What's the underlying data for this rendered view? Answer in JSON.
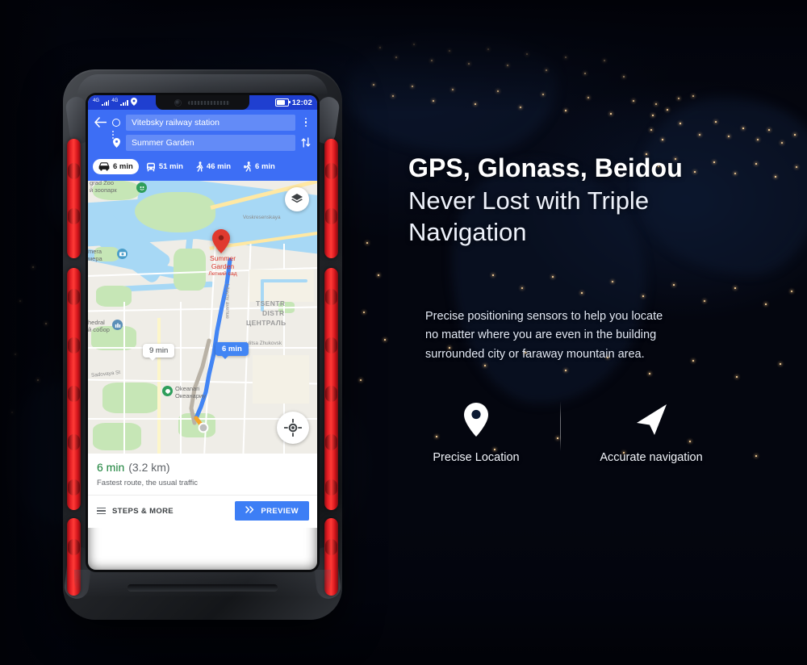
{
  "background": {
    "scene": "night-earth-satellite",
    "base_color": "#04060f",
    "city_light_color": "#ffd9a0"
  },
  "panel": {
    "headline_bold": "GPS, Glonass, Beidou",
    "headline_light_line1": "Never Lost with Triple",
    "headline_light_line2": "Navigation",
    "description_line1": "Precise positioning sensors to help you locate",
    "description_line2": "no matter where you are even in the building",
    "description_line3": "surrounded city or faraway mountain area."
  },
  "features": [
    {
      "icon": "map-pin-icon",
      "label": "Precise Location"
    },
    {
      "icon": "navigation-arrow-icon",
      "label": "Accurate navigation"
    }
  ],
  "phone": {
    "accent_color": "#e01b22",
    "body_color": "#26282d",
    "statusbar": {
      "network_1": "4G",
      "network_2": "4G",
      "location_icon": "location-icon",
      "battery_icon": "battery-icon",
      "clock": "12:02"
    },
    "directions": {
      "back_icon": "back-arrow-icon",
      "origin_icon": "origin-circle-icon",
      "origin_value": "Vitebsky railway station",
      "destination_icon": "destination-pin-icon",
      "destination_value": "Summer Garden",
      "menu_icon": "overflow-menu-icon",
      "swap_icon": "swap-arrows-icon"
    },
    "travel_modes": [
      {
        "icon": "car-icon",
        "time": "6 min",
        "selected": true
      },
      {
        "icon": "transit-icon",
        "time": "51 min",
        "selected": false
      },
      {
        "icon": "walk-icon",
        "time": "46 min",
        "selected": false
      },
      {
        "icon": "rideshare-icon",
        "time": "6 min",
        "selected": false
      }
    ],
    "map": {
      "labels": [
        {
          "en": "grad Zoo",
          "ru": "й зоопарк"
        },
        {
          "en": "mera",
          "ru": "мера"
        },
        {
          "en": "hedral",
          "ru": "й собор"
        },
        {
          "en": "Okeanari",
          "ru": "Океанариу"
        }
      ],
      "place_label_en": "Summer",
      "place_label_en2": "Garden",
      "place_label_ru": "Летний сад",
      "street_1": "Voskresenskaya",
      "street_2": "Liteyny avenue",
      "street_3": "ulitsa Zhukovsk",
      "street_4": "Sadovaya St",
      "district_line1": "TSENTR",
      "district_line2": "DISTR",
      "district_line3": "ЦЕНТРАЛЬ",
      "route_badge_primary": "6 min",
      "route_badge_alt": "9 min",
      "layers_icon": "layers-icon",
      "my_location_icon": "my-location-icon",
      "route_color": "#4285f4"
    },
    "card": {
      "eta": "6 min",
      "distance": "(3.2 km)",
      "subtitle": "Fastest route, the usual traffic",
      "steps_icon": "list-icon",
      "steps_label": "STEPS & MORE",
      "preview_icon": "double-chevron-icon",
      "preview_label": "PREVIEW"
    }
  }
}
